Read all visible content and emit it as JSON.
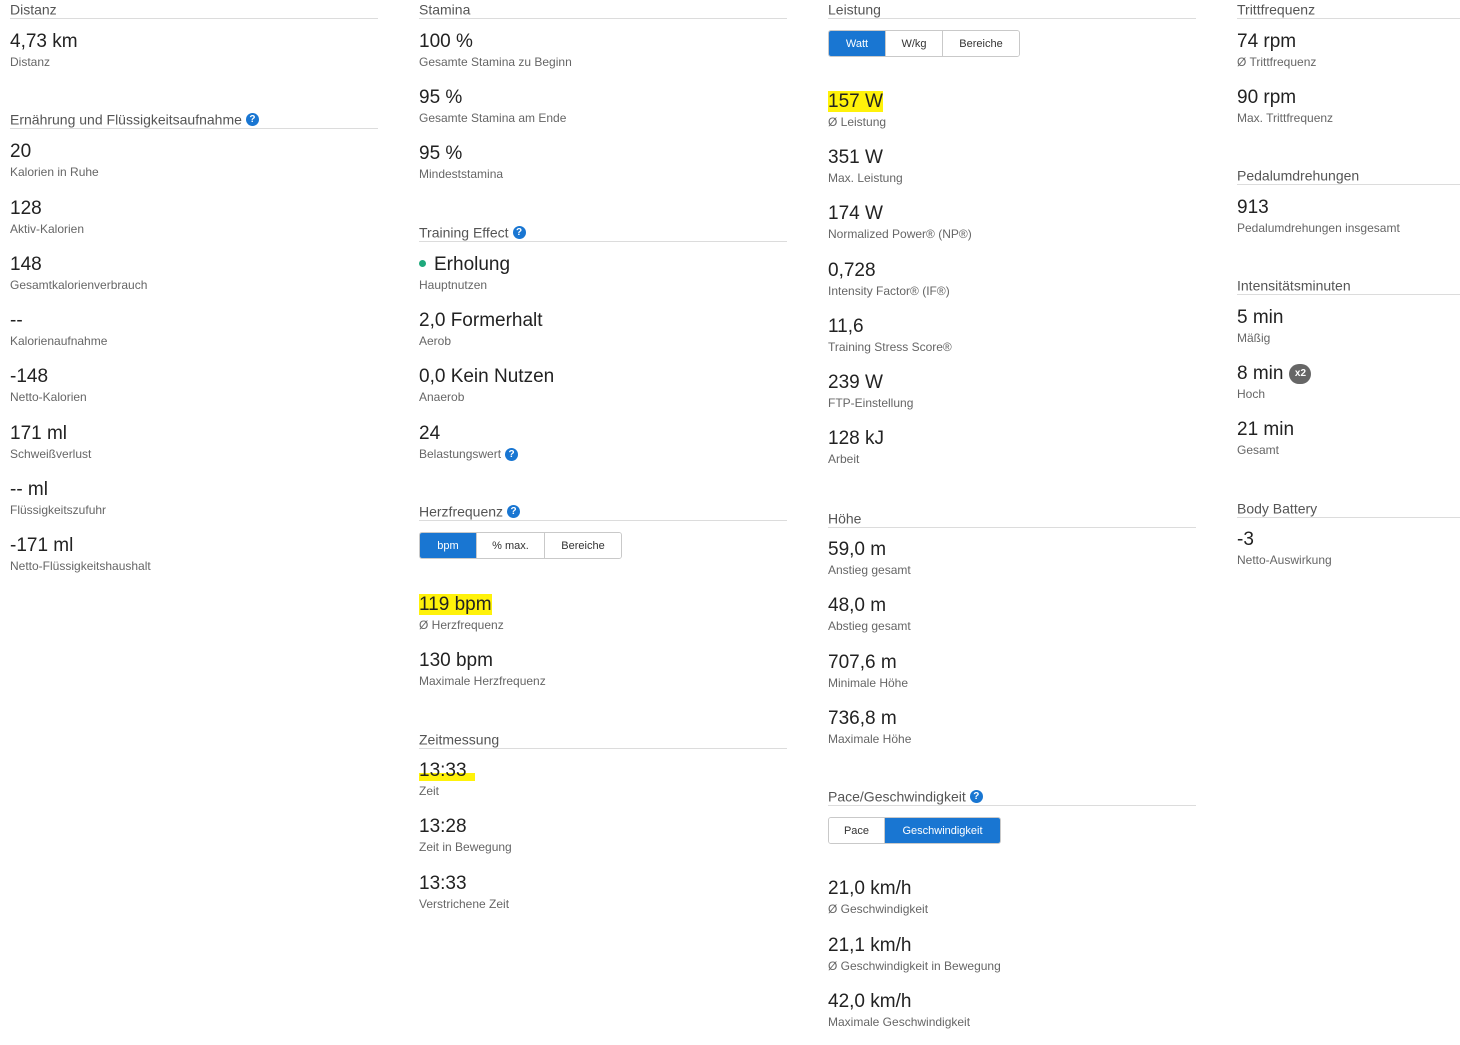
{
  "col1": {
    "distanz": {
      "title": "Distanz",
      "stats": [
        {
          "value": "4,73 km",
          "label": "Distanz"
        }
      ]
    },
    "ernaehrung": {
      "title": "Ernährung und Flüssigkeitsaufnahme",
      "stats": [
        {
          "value": "20",
          "label": "Kalorien in Ruhe"
        },
        {
          "value": "128",
          "label": "Aktiv-Kalorien"
        },
        {
          "value": "148",
          "label": "Gesamtkalorienverbrauch"
        },
        {
          "value": "--",
          "label": "Kalorienaufnahme"
        },
        {
          "value": "-148",
          "label": "Netto-Kalorien"
        },
        {
          "value": "171 ml",
          "label": "Schweißverlust"
        },
        {
          "value": "-- ml",
          "label": "Flüssigkeitszufuhr"
        },
        {
          "value": "-171 ml",
          "label": "Netto-Flüssigkeitshaushalt"
        }
      ]
    }
  },
  "col2": {
    "stamina": {
      "title": "Stamina",
      "stats": [
        {
          "value": "100 %",
          "label": "Gesamte Stamina zu Beginn"
        },
        {
          "value": "95 %",
          "label": "Gesamte Stamina am Ende"
        },
        {
          "value": "95 %",
          "label": "Mindeststamina"
        }
      ]
    },
    "training": {
      "title": "Training Effect",
      "stats": [
        {
          "value": "Erholung",
          "label": "Hauptnutzen"
        },
        {
          "value": "2,0 Formerhalt",
          "label": "Aerob"
        },
        {
          "value": "0,0 Kein Nutzen",
          "label": "Anaerob"
        },
        {
          "value": "24",
          "label": "Belastungswert"
        }
      ]
    },
    "herz": {
      "title": "Herzfrequenz",
      "tabs": [
        "bpm",
        "% max.",
        "Bereiche"
      ],
      "stats": [
        {
          "value": "119 bpm",
          "label": "Ø Herzfrequenz"
        },
        {
          "value": "130 bpm",
          "label": "Maximale Herzfrequenz"
        }
      ]
    },
    "zeit": {
      "title": "Zeitmessung",
      "stats": [
        {
          "value": "13:33",
          "label": "Zeit"
        },
        {
          "value": "13:28",
          "label": "Zeit in Bewegung"
        },
        {
          "value": "13:33",
          "label": "Verstrichene Zeit"
        }
      ]
    }
  },
  "col3": {
    "leistung": {
      "title": "Leistung",
      "tabs": [
        "Watt",
        "W/kg",
        "Bereiche"
      ],
      "stats": [
        {
          "value": "157 W",
          "label": "Ø Leistung"
        },
        {
          "value": "351 W",
          "label": "Max. Leistung"
        },
        {
          "value": "174 W",
          "label": "Normalized Power® (NP®)"
        },
        {
          "value": "0,728",
          "label": "Intensity Factor® (IF®)"
        },
        {
          "value": "11,6",
          "label": "Training Stress Score®"
        },
        {
          "value": "239 W",
          "label": "FTP-Einstellung"
        },
        {
          "value": "128 kJ",
          "label": "Arbeit"
        }
      ]
    },
    "hoehe": {
      "title": "Höhe",
      "stats": [
        {
          "value": "59,0 m",
          "label": "Anstieg gesamt"
        },
        {
          "value": "48,0 m",
          "label": "Abstieg gesamt"
        },
        {
          "value": "707,6 m",
          "label": "Minimale Höhe"
        },
        {
          "value": "736,8 m",
          "label": "Maximale Höhe"
        }
      ]
    },
    "pace": {
      "title": "Pace/Geschwindigkeit",
      "tabs": [
        "Pace",
        "Geschwindigkeit"
      ],
      "stats": [
        {
          "value": "21,0 km/h",
          "label": "Ø Geschwindigkeit"
        },
        {
          "value": "21,1 km/h",
          "label": "Ø Geschwindigkeit in Bewegung"
        },
        {
          "value": "42,0 km/h",
          "label": "Maximale Geschwindigkeit"
        }
      ]
    }
  },
  "col4": {
    "tritt": {
      "title": "Trittfrequenz",
      "stats": [
        {
          "value": "74 rpm",
          "label": "Ø Trittfrequenz"
        },
        {
          "value": "90 rpm",
          "label": "Max. Trittfrequenz"
        }
      ]
    },
    "pedal": {
      "title": "Pedalumdrehungen",
      "stats": [
        {
          "value": "913",
          "label": "Pedalumdrehungen insgesamt"
        }
      ]
    },
    "intens": {
      "title": "Intensitätsminuten",
      "badge": "x2",
      "stats": [
        {
          "value": "5 min",
          "label": "Mäßig"
        },
        {
          "value": "8 min",
          "label": "Hoch"
        },
        {
          "value": "21 min",
          "label": "Gesamt"
        }
      ]
    },
    "battery": {
      "title": "Body Battery",
      "stats": [
        {
          "value": "-3",
          "label": "Netto-Auswirkung"
        }
      ]
    }
  },
  "colors": {
    "accent": "#1976d2",
    "highlight": "#fff20a",
    "recovery_dot": "#1ea97c",
    "badge": "#666666"
  },
  "icons": {
    "help": "question-mark-circle-icon",
    "training_dot": "status-dot-icon"
  },
  "help_glyph": "?"
}
